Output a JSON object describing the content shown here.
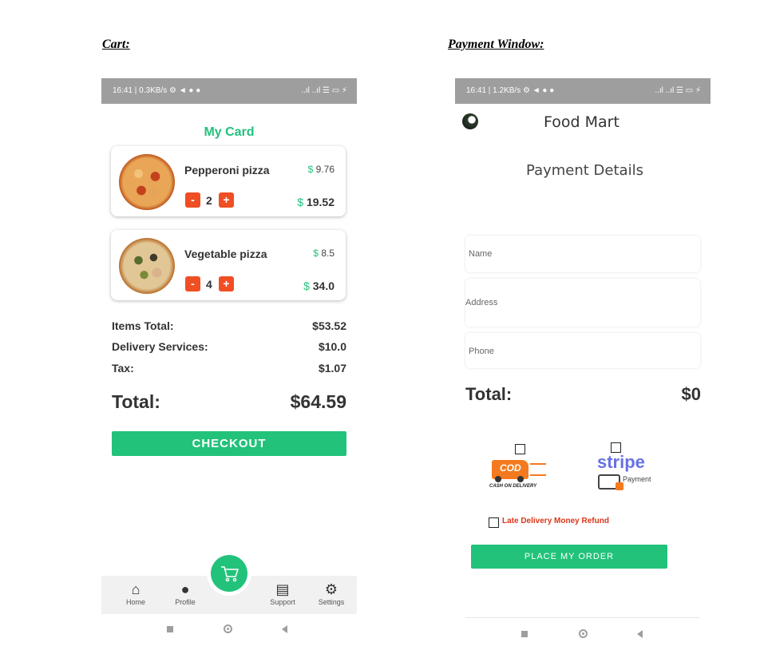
{
  "captions": {
    "cart": "Cart:",
    "payment": "Payment Window:"
  },
  "cart": {
    "status": {
      "time": "16:41 | 0.3KB/s ⚙ ◄ ● ●",
      "right": "..ıl ..ıl ☰ ▭ ⚡"
    },
    "title": "My Card",
    "items": [
      {
        "name": "Pepperoni pizza",
        "currency": "$",
        "price": "9.76",
        "minus": "-",
        "qty": "2",
        "plus": "+",
        "line_total": "19.52"
      },
      {
        "name": "Vegetable pizza",
        "currency": "$",
        "price": "8.5",
        "minus": "-",
        "qty": "4",
        "plus": "+",
        "line_total": "34.0"
      }
    ],
    "summary": [
      {
        "label": "Items Total:",
        "value": "$53.52"
      },
      {
        "label": "Delivery Services:",
        "value": "$10.0"
      },
      {
        "label": "Tax:",
        "value": "$1.07"
      }
    ],
    "total_label": "Total:",
    "total_value": "$64.59",
    "checkout_label": "CHECKOUT",
    "nav": [
      {
        "label": "Home",
        "icon": "home-icon"
      },
      {
        "label": "Profile",
        "icon": "profile-icon"
      },
      {
        "label": "Support",
        "icon": "support-icon"
      },
      {
        "label": "Settings",
        "icon": "settings-icon"
      }
    ],
    "fab_icon": "cart-icon"
  },
  "payment": {
    "status": {
      "time": "16:41 | 1.2KB/s ⚙ ◄ ● ●",
      "right": "..ıl ..ıl ☰ ▭ ⚡"
    },
    "app_title": "Food Mart",
    "section_title": "Payment Details",
    "fields": [
      {
        "placeholder": "Name"
      },
      {
        "placeholder": "Address"
      },
      {
        "placeholder": "Phone"
      }
    ],
    "total_label": "Total:",
    "total_value": "$0",
    "cod": {
      "badge": "COD",
      "caption": "CASH ON DELIVERY"
    },
    "stripe": {
      "brand": "stripe",
      "sub": "Payment"
    },
    "refund_label": "Late Delivery Money Refund",
    "place_order_label": "PLACE MY ORDER"
  },
  "colors": {
    "accent": "#22c27a",
    "qty_button": "#f04e23",
    "status_bar": "#9e9e9e"
  }
}
